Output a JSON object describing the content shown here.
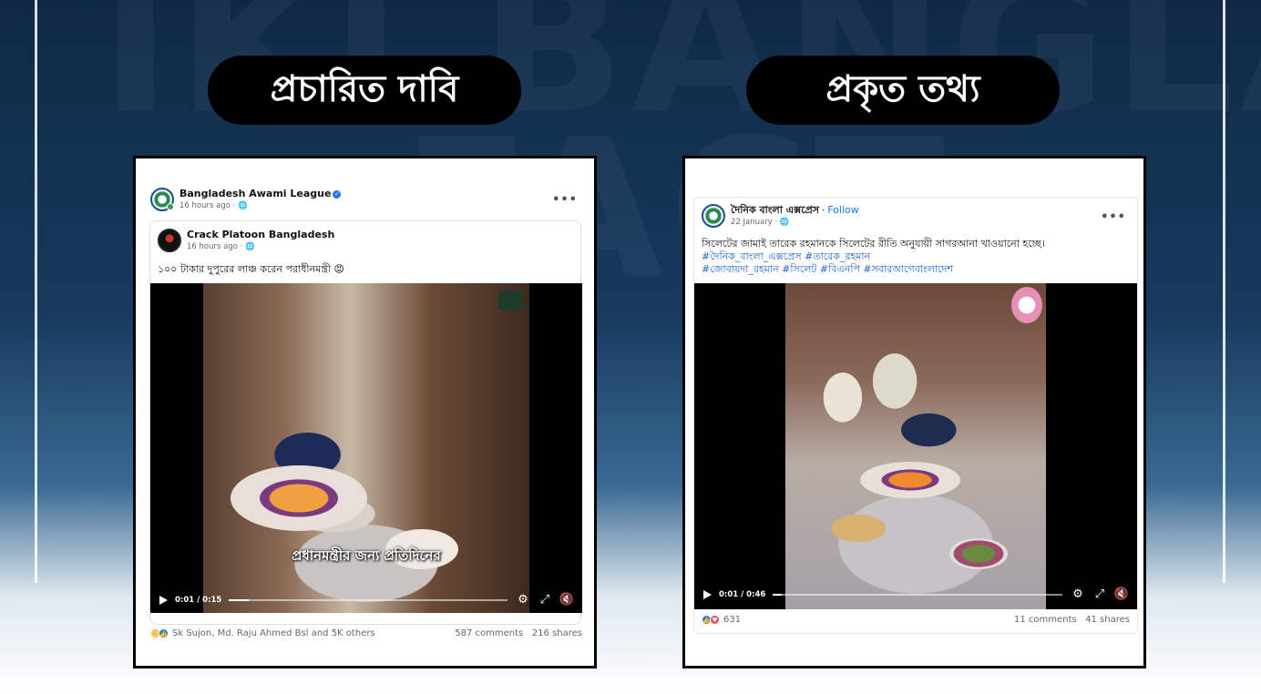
{
  "watermark": {
    "line1": "IKI BANGLA",
    "line2": "FACT"
  },
  "labels": {
    "claim": "প্রচারিত দাবি",
    "fact": "প্রকৃত তথ্য"
  },
  "left_post": {
    "author": "Bangladesh Awami League",
    "meta": "16 hours ago · 🌐",
    "shared_author": "Crack Platoon Bangladesh",
    "shared_meta": "16 hours ago · 🌐",
    "caption": "১০০ টাকার দুপুরের লাঞ্চ করেন পরাধীনমন্ত্রী 😡",
    "video_subtitle": "প্রধানমন্ত্রীর জন্য প্রতিদিনের",
    "video_time": "0:01 / 0:15",
    "video_progress": 0.07,
    "reactions_text": "Sk Sujon, Md. Raju Ahmed Bsl and 5K others",
    "comments": "587 comments",
    "shares": "216 shares"
  },
  "right_post": {
    "author": "দৈনিক বাংলা এক্সপ্রেস",
    "follow": "Follow",
    "meta": "22 January · 🌐",
    "caption": "সিলেটের জামাই তারেক রহমানকে সিলেটের রীতি অনুযায়ী সাগরআনা খাওয়ানো হচ্ছে।",
    "hashtags_line1": "#দৈনিক_বাংলা_এক্সপ্রেস #তারেক_রহমান",
    "hashtags_line2": "#জোবায়দা_রহমান #সিলেট #বিএনপি #সবারআগেবাংলাদেশ",
    "video_time": "0:01 / 0:46",
    "video_progress": 0.03,
    "reaction_count": "631",
    "comments": "11 comments",
    "shares": "41 shares"
  },
  "icons": {
    "more": "•••",
    "settings": "⚙",
    "fullscreen": "⤢",
    "mute": "🔇"
  },
  "colors": {
    "link": "#1c64d4",
    "facebook_blue": "#1877f2",
    "pill": "#000000"
  }
}
